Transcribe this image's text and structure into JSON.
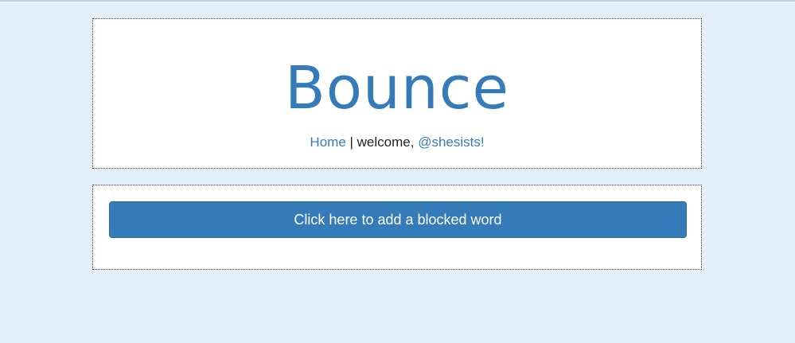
{
  "header": {
    "brand_title": "Bounce",
    "nav": {
      "home_link": "Home",
      "separator": " | ",
      "welcome_text": "welcome, ",
      "user_link": "@shesists!"
    }
  },
  "actions": {
    "add_blocked_word_label": "Click here to add a blocked word"
  },
  "colors": {
    "page_background": "#e4f0fc",
    "accent": "#357ab9",
    "panel_background": "#ffffff"
  }
}
